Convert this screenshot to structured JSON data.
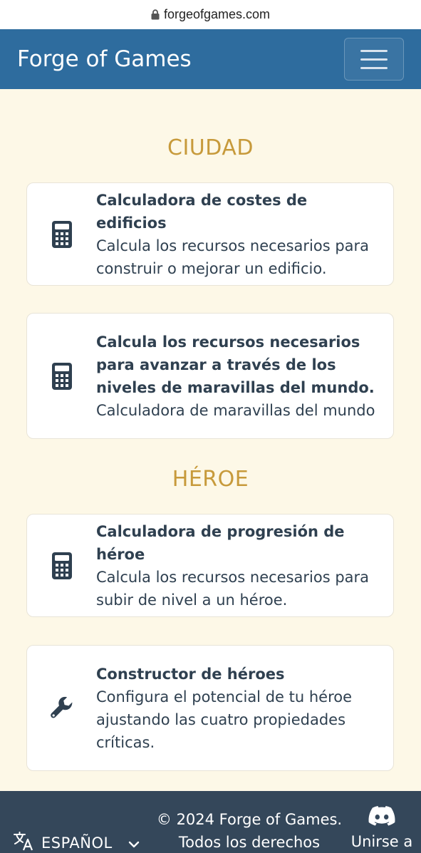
{
  "browser": {
    "url": "forgeofgames.com"
  },
  "navbar": {
    "brand": "Forge of Games"
  },
  "sections": [
    {
      "title": "CIUDAD",
      "cards": [
        {
          "title": "Calculadora de costes de edificios",
          "description": "Calcula los recursos necesarios para construir o mejorar un edificio.",
          "icon": "calculator-icon"
        },
        {
          "title": "Calcula los recursos necesarios para avanzar a través de los niveles de maravillas del mundo.",
          "description": "Calculadora de maravillas del mundo",
          "icon": "calculator-icon"
        }
      ]
    },
    {
      "title": "HÉROE",
      "cards": [
        {
          "title": "Calculadora de progresión de héroe",
          "description": "Calcula los recursos necesarios para subir de nivel a un héroe.",
          "icon": "calculator-icon"
        },
        {
          "title": "Constructor de héroes",
          "description": "Configura el potencial de tu héroe ajustando las cuatro propiedades críticas.",
          "icon": "wrench-icon"
        }
      ]
    }
  ],
  "footer": {
    "language": "ESPAÑOL",
    "copyright": "© 2024 Forge of Games. Todos los derechos",
    "discord_label": "Unirse a"
  },
  "colors": {
    "navbar_bg": "#2e6c9e",
    "page_bg": "#fdf8e7",
    "section_title": "#c79a3b",
    "card_text": "#2f4050",
    "footer_bg": "#34475a"
  }
}
